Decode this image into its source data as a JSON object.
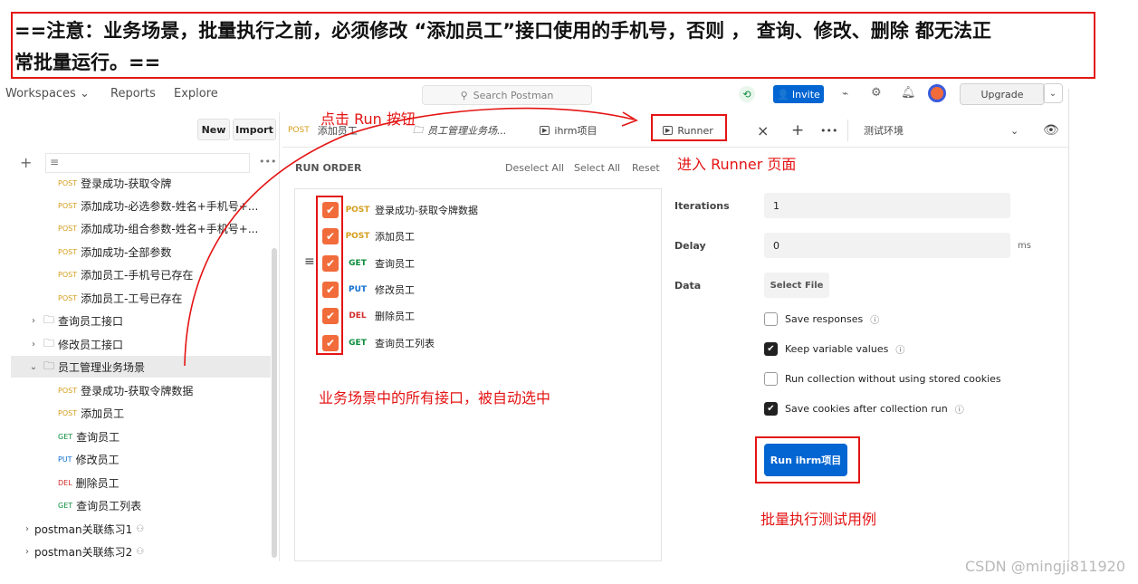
{
  "banner": {
    "line1": "==注意：业务场景，批量执行之前，必须修改 “添加员工”接口使用的手机号，否则 ， 查询、修改、删除 都无法正",
    "line2": "常批量运行。=="
  },
  "topbar": {
    "nav": [
      "Workspaces",
      "Reports",
      "Explore"
    ],
    "search_placeholder": "Search Postman",
    "invite_label": "Invite",
    "upgrade_label": "Upgrade"
  },
  "sidebar": {
    "new_label": "New",
    "import_label": "Import",
    "tree": [
      {
        "method": "POST",
        "label": "登录成功-获取令牌"
      },
      {
        "method": "POST",
        "label": "添加成功-必选参数-姓名+手机号+..."
      },
      {
        "method": "POST",
        "label": "添加成功-组合参数-姓名+手机号+..."
      },
      {
        "method": "POST",
        "label": "添加成功-全部参数"
      },
      {
        "method": "POST",
        "label": "添加员工-手机号已存在"
      },
      {
        "method": "POST",
        "label": "添加员工-工号已存在"
      },
      {
        "folder": true,
        "label": "查询员工接口"
      },
      {
        "folder": true,
        "label": "修改员工接口"
      },
      {
        "folder": true,
        "open": true,
        "label": "员工管理业务场景"
      },
      {
        "method": "POST",
        "label": "登录成功-获取令牌数据"
      },
      {
        "method": "POST",
        "label": "添加员工"
      },
      {
        "method": "GET",
        "label": "查询员工"
      },
      {
        "method": "PUT",
        "label": "修改员工"
      },
      {
        "method": "DEL",
        "label": "删除员工"
      },
      {
        "method": "GET",
        "label": "查询员工列表"
      },
      {
        "collection": true,
        "label": "postman关联练习1"
      },
      {
        "collection": true,
        "label": "postman关联练习2"
      }
    ]
  },
  "tabs": {
    "tab1_method": "POST",
    "tab1_label": "添加员工",
    "tab2_label": "员工管理业务场...",
    "tab3_label": "ihrm项目",
    "tab4_label": "Runner",
    "env_label": "测试环境"
  },
  "run_order": {
    "title": "RUN ORDER",
    "deselect_all": "Deselect All",
    "select_all": "Select All",
    "reset": "Reset",
    "items": [
      {
        "method": "POST",
        "label": "登录成功-获取令牌数据"
      },
      {
        "method": "POST",
        "label": "添加员工"
      },
      {
        "method": "GET",
        "label": "查询员工"
      },
      {
        "method": "PUT",
        "label": "修改员工"
      },
      {
        "method": "DEL",
        "label": "删除员工"
      },
      {
        "method": "GET",
        "label": "查询员工列表"
      }
    ]
  },
  "config": {
    "iterations_label": "Iterations",
    "iterations_value": "1",
    "delay_label": "Delay",
    "delay_value": "0",
    "delay_unit": "ms",
    "data_label": "Data",
    "select_file": "Select File",
    "options": [
      {
        "label": "Save responses",
        "checked": false
      },
      {
        "label": "Keep variable values",
        "checked": true
      },
      {
        "label": "Run collection without using stored cookies",
        "checked": false
      },
      {
        "label": "Save cookies after collection run",
        "checked": true
      }
    ],
    "run_button": "Run ihrm项目"
  },
  "annotations": {
    "click_run": "点击 Run 按钮",
    "enter_runner": "进入 Runner 页面",
    "auto_selected": "业务场景中的所有接口，被自动选中",
    "batch_run": "批量执行测试用例"
  },
  "watermark": "CSDN @mingji811920",
  "colors": {
    "annotation_red": "#e41414",
    "checkbox_orange": "#f26b3a",
    "run_button_blue": "#0265d2",
    "post": "#d59d1c",
    "get": "#0b8c3b",
    "put": "#0f6fcf",
    "del": "#d22c2c"
  }
}
